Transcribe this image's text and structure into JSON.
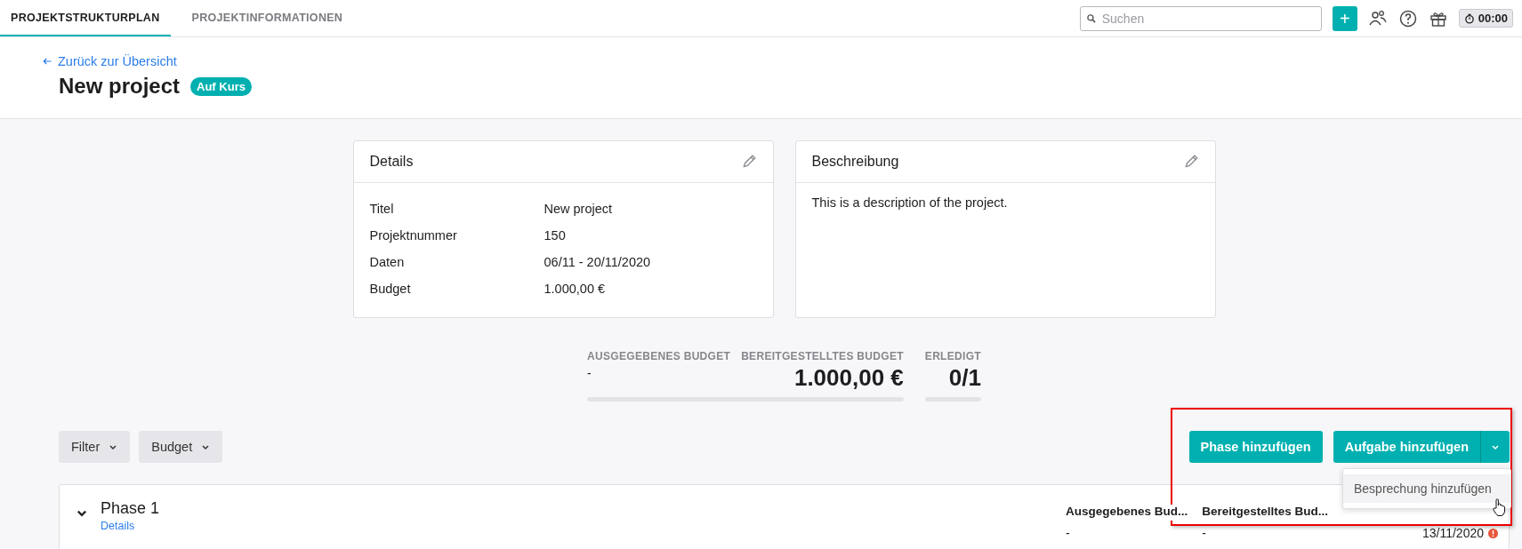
{
  "top_nav": {
    "tabs": [
      {
        "label": "PROJEKTSTRUKTURPLAN",
        "selected": true
      },
      {
        "label": "PROJEKTINFORMATIONEN",
        "selected": false
      }
    ],
    "search": {
      "placeholder": "Suchen"
    },
    "add_button": "+",
    "timer": "00:00"
  },
  "header": {
    "back_link": "Zurück zur Übersicht",
    "title": "New project",
    "status_badge": "Auf Kurs"
  },
  "details_card": {
    "title": "Details",
    "rows": [
      {
        "label": "Titel",
        "value": "New project"
      },
      {
        "label": "Projektnummer",
        "value": "150"
      },
      {
        "label": "Daten",
        "value": "06/11 - 20/11/2020"
      },
      {
        "label": "Budget",
        "value": "1.000,00 €"
      }
    ]
  },
  "description_card": {
    "title": "Beschreibung",
    "text": "This is a description of the project."
  },
  "stat_groups": [
    {
      "level": 0,
      "items": [
        {
          "label": "AUSGEGEBENES BUDGET",
          "value": "-"
        },
        {
          "label": "BEREITGESTELLTES BUDGET",
          "value": "1.000,00 €"
        }
      ]
    },
    {
      "level": 0,
      "items": [
        {
          "label": "ERLEDIGT",
          "value": "0/1"
        }
      ]
    }
  ],
  "filters": [
    {
      "label": "Filter"
    },
    {
      "label": "Budget"
    }
  ],
  "actions": {
    "phase_button": "Phase hinzufügen",
    "task_button": "Aufgabe hinzufügen",
    "menu": [
      {
        "label": "Besprechung hinzufügen",
        "selected": true
      }
    ]
  },
  "phases": [
    {
      "title": "Phase 1",
      "link": "Details",
      "expanded": true,
      "columns": [
        {
          "header": "Ausgegebenes Bud...",
          "value": "-",
          "overdue": false
        },
        {
          "header": "Bereitgestelltes Bud...",
          "value": "-",
          "overdue": false
        },
        {
          "value": "13/11/2020",
          "overdue": true
        }
      ]
    }
  ]
}
